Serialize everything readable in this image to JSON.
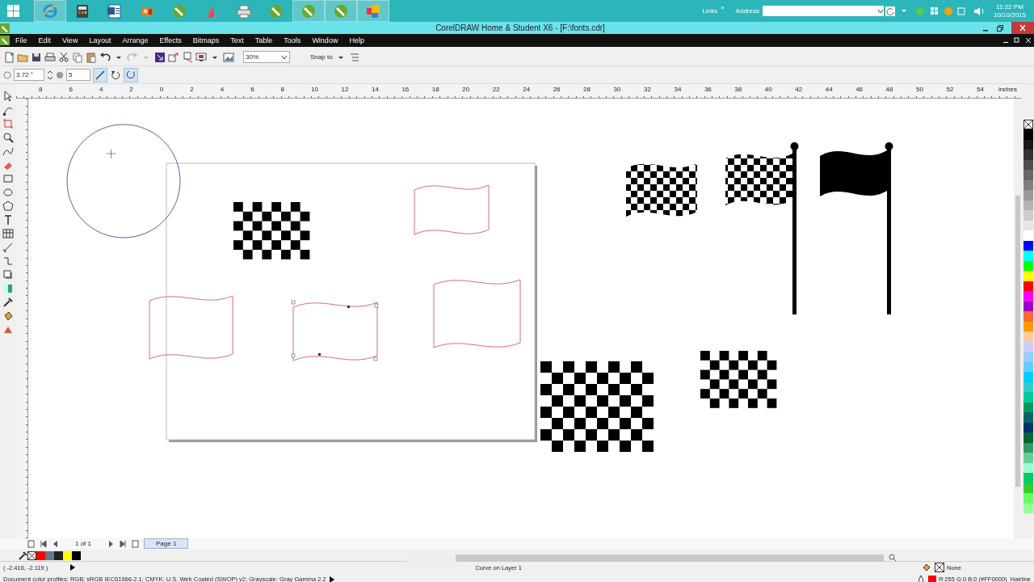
{
  "taskbar": {
    "apps": [
      {
        "kind": "start",
        "running": false
      },
      {
        "kind": "browser",
        "running": true
      },
      {
        "kind": "calculator",
        "running": false
      },
      {
        "kind": "document",
        "running": false
      },
      {
        "kind": "film",
        "running": false
      },
      {
        "kind": "pen",
        "running": false
      },
      {
        "kind": "chart",
        "running": false
      },
      {
        "kind": "printer",
        "running": false
      },
      {
        "kind": "pen",
        "running": false
      },
      {
        "kind": "pen",
        "running": true
      },
      {
        "kind": "pen",
        "running": true
      },
      {
        "kind": "tiles",
        "running": true
      }
    ],
    "links": "Links",
    "links_more": "»",
    "address_label": "Address",
    "time": "11:22 PM",
    "date": "10/10/2015"
  },
  "window": {
    "title": "CorelDRAW Home & Student X6 - [F:\\fonts.cdr]"
  },
  "menu": [
    "File",
    "Edit",
    "View",
    "Layout",
    "Arrange",
    "Effects",
    "Bitmaps",
    "Text",
    "Table",
    "Tools",
    "Window",
    "Help"
  ],
  "toolbar": {
    "zoom": "30%",
    "snap": "Snap to"
  },
  "property_bar": {
    "angle": "3.72 °",
    "steps": "5"
  },
  "ruler": {
    "labels": [
      "8",
      "6",
      "4",
      "2",
      "0",
      "2",
      "4",
      "6",
      "8",
      "10",
      "12",
      "14",
      "16",
      "18",
      "20",
      "22",
      "24",
      "26",
      "28",
      "30",
      "32",
      "34",
      "36",
      "38",
      "40",
      "42",
      "44",
      "46",
      "48",
      "50",
      "52",
      "54"
    ],
    "unit": "inches"
  },
  "pages": {
    "count": "1 of 1",
    "tab": "Page 1"
  },
  "document_palette": [
    {
      "color": "#ff0000"
    },
    {
      "color": "#667788"
    },
    {
      "color": "#222222"
    },
    {
      "color": "#ffff00"
    },
    {
      "color": "#000000"
    }
  ],
  "palette": [
    {
      "color": "#000000"
    },
    {
      "color": "#1a1a1a"
    },
    {
      "color": "#333333"
    },
    {
      "color": "#4d4d4d"
    },
    {
      "color": "#666666"
    },
    {
      "color": "#808080"
    },
    {
      "color": "#999999"
    },
    {
      "color": "#b3b3b3"
    },
    {
      "color": "#cccccc"
    },
    {
      "color": "#e6e6e6"
    },
    {
      "color": "#ffffff"
    },
    {
      "color": "#0000ff"
    },
    {
      "color": "#00ffff"
    },
    {
      "color": "#00ff00"
    },
    {
      "color": "#ffff00"
    },
    {
      "color": "#ff0000"
    },
    {
      "color": "#ff00ff"
    },
    {
      "color": "#9900cc"
    },
    {
      "color": "#ff6633"
    },
    {
      "color": "#ff9900"
    },
    {
      "color": "#ffcc99"
    },
    {
      "color": "#ccccff"
    },
    {
      "color": "#99ccff"
    },
    {
      "color": "#66ccff"
    },
    {
      "color": "#00ccff"
    },
    {
      "color": "#33cccc"
    },
    {
      "color": "#00cc99"
    },
    {
      "color": "#009966"
    },
    {
      "color": "#006666"
    },
    {
      "color": "#003366"
    },
    {
      "color": "#006633"
    },
    {
      "color": "#339966"
    },
    {
      "color": "#66cc99"
    },
    {
      "color": "#99ffcc"
    },
    {
      "color": "#00cc66"
    },
    {
      "color": "#33cc33"
    },
    {
      "color": "#66ff66"
    },
    {
      "color": "#99ff99"
    }
  ],
  "status": {
    "coordinates": "( -2.416, -2.119 )",
    "object": "Curve on Layer 1",
    "profiles": "Document color profiles: RGB: sRGB IEC61966-2.1; CMYK: U.S. Web Coated (SWOP) v2; Grayscale: Gray Gamma 2.2",
    "fill": "None",
    "outline_swatch": {
      "color": "#ff0000"
    },
    "outline": "R:255 G:0 B:0 (#FF0000)",
    "outline_width": "Hairline"
  }
}
